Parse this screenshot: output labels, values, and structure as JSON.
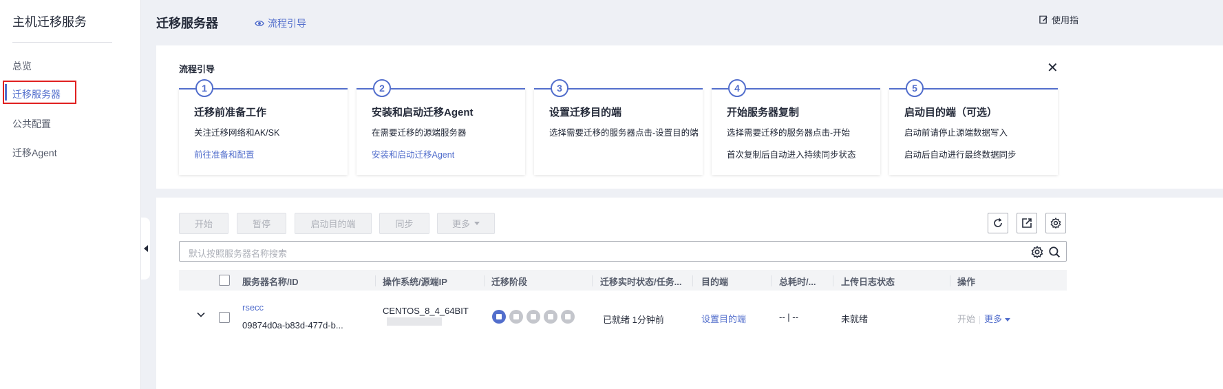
{
  "sidebar": {
    "title": "主机迁移服务",
    "items": [
      {
        "label": "总览"
      },
      {
        "label": "迁移服务器"
      },
      {
        "label": "公共配置"
      },
      {
        "label": "迁移Agent"
      }
    ]
  },
  "header": {
    "title": "迁移服务器",
    "guide_link": "流程引导",
    "manual_link": "使用指"
  },
  "flow": {
    "title": "流程引导",
    "steps": [
      {
        "num": "1",
        "title": "迁移前准备工作",
        "desc": "关注迁移网络和AK/SK",
        "link": "前往准备和配置"
      },
      {
        "num": "2",
        "title": "安装和启动迁移Agent",
        "desc": "在需要迁移的源端服务器",
        "link": "安装和启动迁移Agent"
      },
      {
        "num": "3",
        "title": "设置迁移目的端",
        "desc": "选择需要迁移的服务器点击-设置目的端"
      },
      {
        "num": "4",
        "title": "开始服务器复制",
        "desc": "选择需要迁移的服务器点击-开始",
        "desc2": "首次复制后自动进入持续同步状态"
      },
      {
        "num": "5",
        "title": "启动目的端（可选）",
        "desc": "启动前请停止源端数据写入",
        "desc2": "启动后自动进行最终数据同步"
      }
    ]
  },
  "toolbar": {
    "start": "开始",
    "pause": "暂停",
    "launch_target": "启动目的端",
    "sync": "同步",
    "more": "更多"
  },
  "search": {
    "placeholder": "默认按照服务器名称搜索"
  },
  "table": {
    "columns": [
      "服务器名称/ID",
      "操作系统/源端IP",
      "迁移阶段",
      "迁移实时状态/任务...",
      "目的端",
      "总耗时/...",
      "上传日志状态",
      "操作"
    ],
    "rows": [
      {
        "name": "rsecc",
        "id": "09874d0a-b83d-477d-b...",
        "os": "CENTOS_8_4_64BIT",
        "status": "已就绪  1分钟前",
        "target": "设置目的端",
        "duration": "-- | --",
        "log_status": "未就绪",
        "op_start": "开始",
        "op_more": "更多"
      }
    ]
  },
  "colors": {
    "accent": "#526ecc",
    "highlight_border": "#e02020"
  }
}
